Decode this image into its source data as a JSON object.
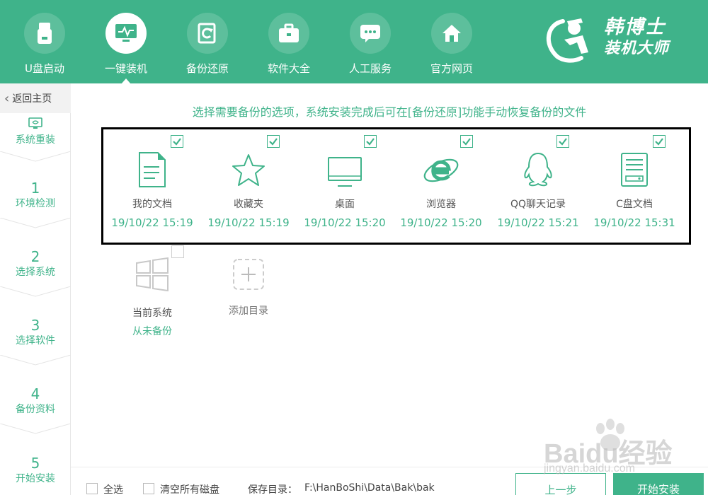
{
  "header": {
    "nav": [
      {
        "label": "U盘启动",
        "icon": "usb-drive-icon"
      },
      {
        "label": "一键装机",
        "icon": "monitor-pulse-icon",
        "active": true
      },
      {
        "label": "备份还原",
        "icon": "backup-restore-icon"
      },
      {
        "label": "软件大全",
        "icon": "briefcase-icon"
      },
      {
        "label": "人工服务",
        "icon": "chat-bubble-icon"
      },
      {
        "label": "官方网页",
        "icon": "home-icon"
      }
    ],
    "logo_line1": "韩博士",
    "logo_line2": "装机大师"
  },
  "sidebar": {
    "back_label": "返回主页",
    "reinstall_label": "系统重装",
    "steps": [
      {
        "num": "1",
        "label": "环境检测"
      },
      {
        "num": "2",
        "label": "选择系统"
      },
      {
        "num": "3",
        "label": "选择软件"
      },
      {
        "num": "4",
        "label": "备份资料"
      },
      {
        "num": "5",
        "label": "开始安装"
      }
    ]
  },
  "main": {
    "instruction": "选择需要备份的选项，系统安装完成后可在[备份还原]功能手动恢复备份的文件",
    "items": [
      {
        "name": "我的文档",
        "time": "19/10/22 15:19",
        "checked": true,
        "icon": "document-icon"
      },
      {
        "name": "收藏夹",
        "time": "19/10/22 15:19",
        "checked": true,
        "icon": "star-icon"
      },
      {
        "name": "桌面",
        "time": "19/10/22 15:20",
        "checked": true,
        "icon": "desktop-icon"
      },
      {
        "name": "浏览器",
        "time": "19/10/22 15:20",
        "checked": true,
        "icon": "ie-browser-icon"
      },
      {
        "name": "QQ聊天记录",
        "time": "19/10/22 15:21",
        "checked": true,
        "icon": "qq-penguin-icon"
      },
      {
        "name": "C盘文档",
        "time": "19/10/22 15:31",
        "checked": true,
        "icon": "drive-document-icon"
      }
    ],
    "current_system": {
      "name": "当前系统",
      "status": "从未备份",
      "checked": false,
      "icon": "windows-icon"
    },
    "add_directory": {
      "name": "添加目录",
      "icon": "add-icon"
    }
  },
  "footer": {
    "select_all": "全选",
    "clear_disks": "清空所有磁盘",
    "save_dir_label": "保存目录：",
    "save_dir_value": "F:\\HanBoShi\\Data\\Bak\\bak",
    "prev_button": "上一步",
    "start_button": "开始安装"
  },
  "watermark": {
    "text": "Baidu经验",
    "url": "jingyan.baidu.com"
  },
  "colors": {
    "brand": "#3fb38a",
    "sidebar_bg": "#ffffff",
    "header_bg": "#3fb38a"
  }
}
